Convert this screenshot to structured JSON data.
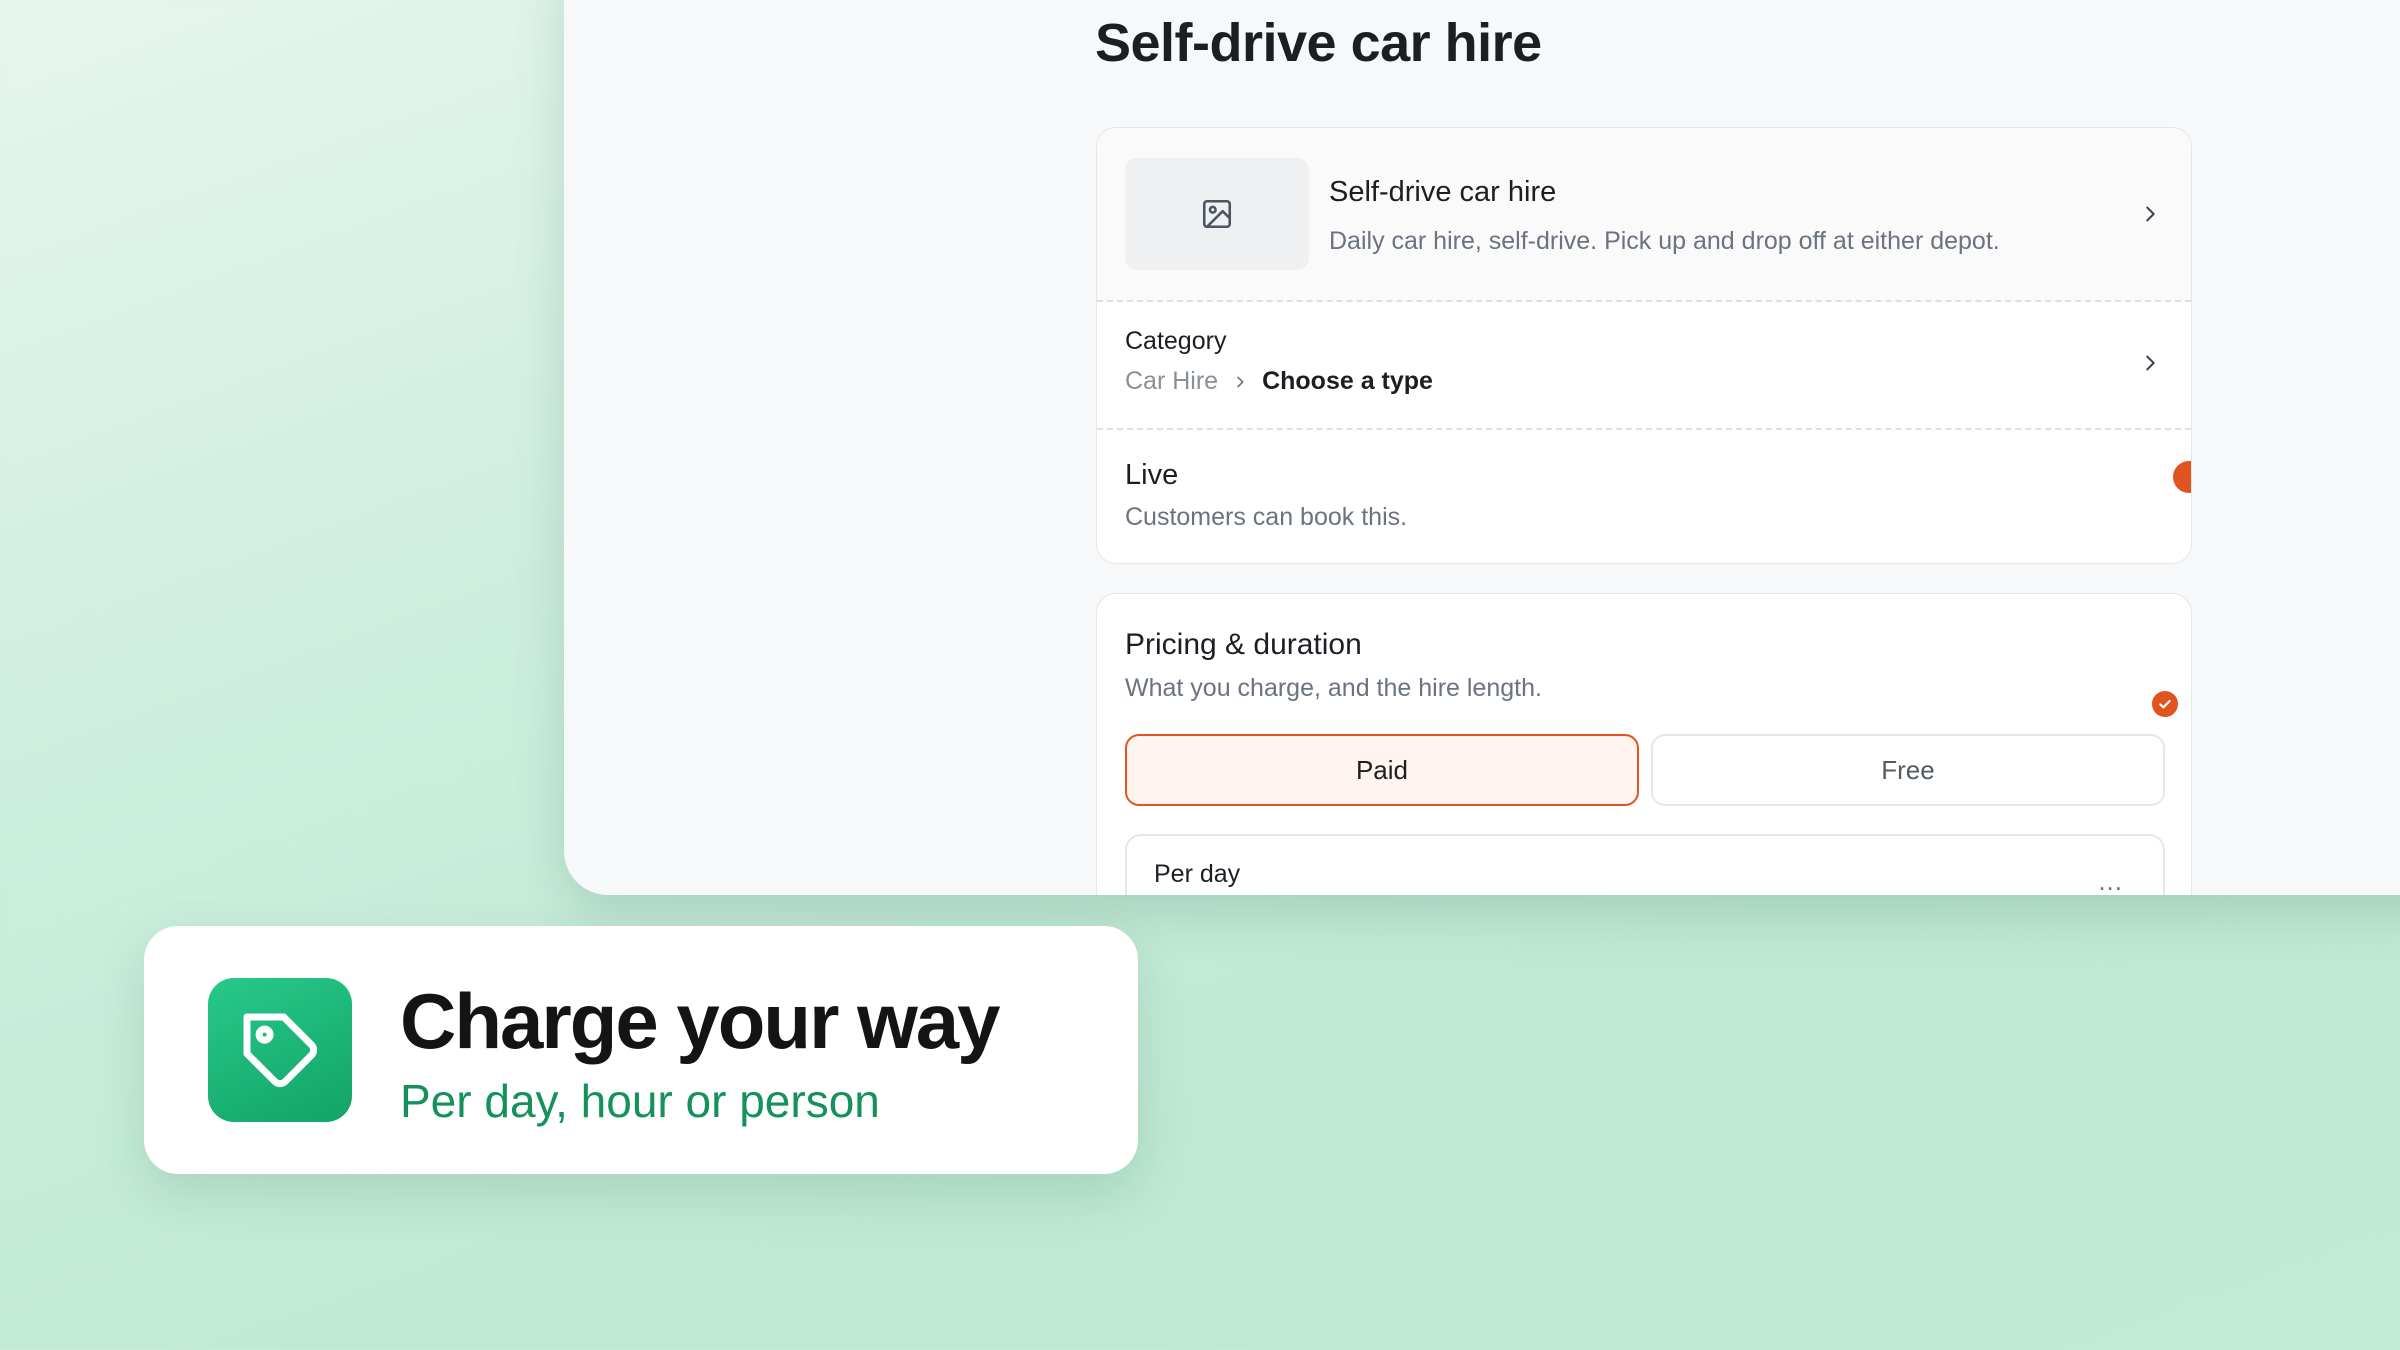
{
  "page": {
    "title": "Self-drive car hire"
  },
  "product": {
    "title": "Self-drive car hire",
    "description": "Daily car hire, self-drive. Pick up and drop off at either depot.",
    "image_icon": "image-icon"
  },
  "category": {
    "label": "Category",
    "parent": "Car Hire",
    "current": "Choose a type"
  },
  "live": {
    "title": "Live",
    "subtitle": "Customers can book this.",
    "enabled": true
  },
  "pricing": {
    "title": "Pricing & duration",
    "subtitle": "What you charge, and the hire length.",
    "options": [
      "Paid",
      "Free"
    ],
    "selected": "Paid",
    "rate_label": "Per day",
    "more_label": "..."
  },
  "feature": {
    "title": "Charge your way",
    "subtitle": "Per day, hour or person",
    "icon": "tag-icon"
  },
  "colors": {
    "accent": "#e2541f",
    "brand_green": "#15925a",
    "background": "#c8ecd9"
  }
}
